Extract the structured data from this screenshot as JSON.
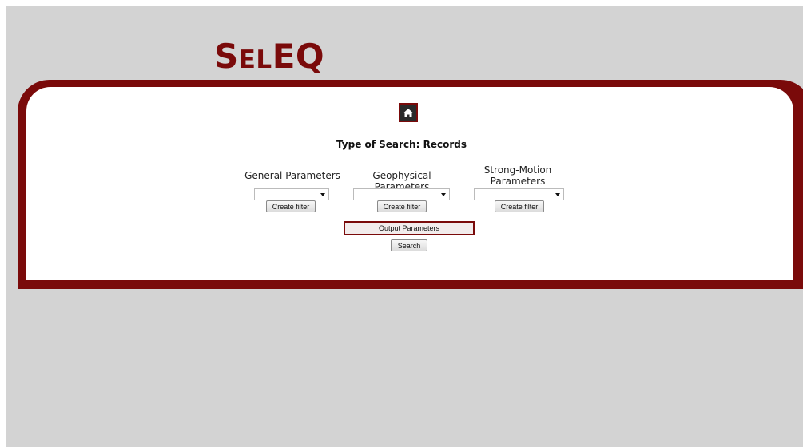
{
  "logo": {
    "prefix": "S",
    "middle": "EL",
    "suffix": "EQ"
  },
  "home": {
    "icon": "home-icon"
  },
  "search_type": {
    "label": "Type of Search: Records"
  },
  "columns": [
    {
      "label": "General Parameters",
      "select_value": "",
      "filter_button": "Create filter"
    },
    {
      "label": "Geophysical Parameters",
      "select_value": "",
      "filter_button": "Create filter"
    },
    {
      "label": "Strong-Motion Parameters",
      "select_value": "",
      "filter_button": "Create filter"
    }
  ],
  "output_button": "Output Parameters",
  "search_button": "Search",
  "colors": {
    "brand": "#7a0a0a",
    "background": "#d3d3d3"
  }
}
